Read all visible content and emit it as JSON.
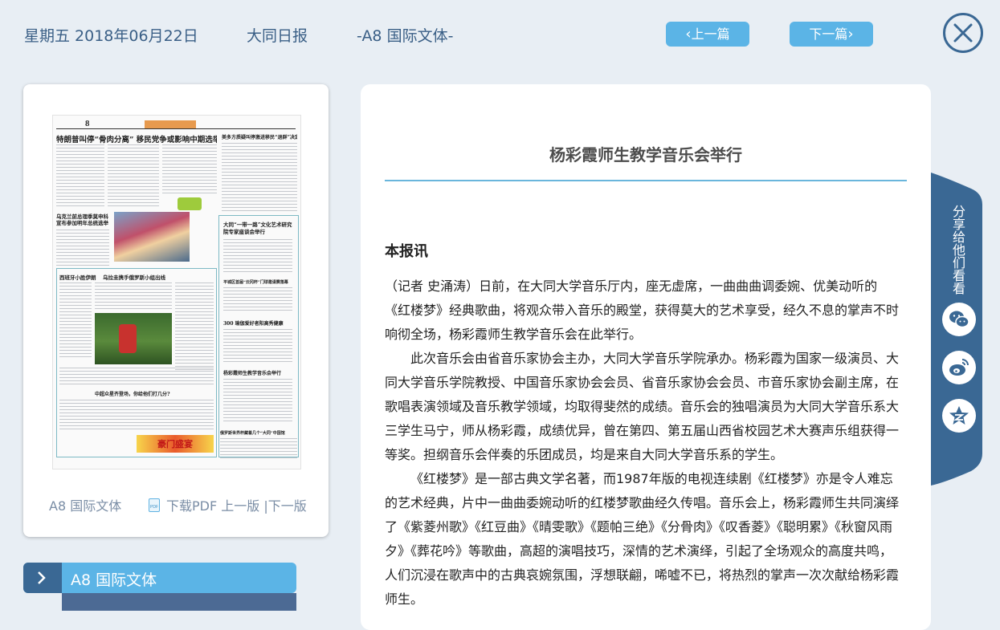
{
  "header": {
    "date": "星期五 2018年06月22日",
    "newspaper": "大同日报",
    "section": "-A8 国际文体-",
    "prev_label": "上一篇",
    "next_label": "下一篇"
  },
  "thumbnail": {
    "page_label": "A8 国际文体",
    "download_label": "下载PDF",
    "prev_page_label": "上一版",
    "separator": "|",
    "next_page_label": "下一版",
    "page_number": "8",
    "headlines": {
      "top": "特朗普叫停“骨肉分离” 移民党争或影响中期选举",
      "right_top": "美多方质疑叫停激进移民“退群”决定",
      "left_mid": "乌克兰前总理季莫申科宣布参加明年总统选举",
      "box_title": "大同“一带一路”文化艺术研究院专家座谈会举行",
      "box_sub": "平城区首届“云冈杯”门球邀请赛落幕",
      "sport_left": "西班牙小胜伊朗",
      "sport_mid": "乌拉圭携手俄罗斯小组出线",
      "sport_right": "300 瑜伽爱好者阳高秀健康",
      "music": "杨彩霞师生教学音乐会举行",
      "china": "中超众星齐登场，你给他们打几分?",
      "bottom_right": "俄罗斯世界杯藏着几个“大同”中国馆",
      "banner": "豪门盛宴"
    }
  },
  "menu": {
    "active_label": "A8  国际文体"
  },
  "article": {
    "title": "杨彩霞师生教学音乐会举行",
    "subhead": "本报讯",
    "paragraphs": [
      "（记者 史涌涛）日前，在大同大学音乐厅内，座无虚席，一曲曲曲调委婉、优美动听的《红楼梦》经典歌曲，将观众带入音乐的殿堂，获得莫大的艺术享受，经久不息的掌声不时响彻全场，杨彩霞师生教学音乐会在此举行。",
      "此次音乐会由省音乐家协会主办，大同大学音乐学院承办。杨彩霞为国家一级演员、大同大学音乐学院教授、中国音乐家协会会员、省音乐家协会会员、市音乐家协会副主席，在歌唱表演领域及音乐教学领域，均取得斐然的成绩。音乐会的独唱演员为大同大学音乐系大三学生马宁，师从杨彩霞，成绩优异，曾在第四、第五届山西省校园艺术大赛声乐组获得一等奖。担纲音乐会伴奏的乐团成员，均是来自大同大学音乐系的学生。",
      "《红楼梦》是一部古典文学名著，而1987年版的电视连续剧《红楼梦》亦是令人难忘的艺术经典，片中一曲曲委婉动听的红楼梦歌曲经久传唱。音乐会上，杨彩霞师生共同演绎了《紫菱州歌》《红豆曲》《晴雯歌》《题帕三绝》《分骨肉》《叹香菱》《聪明累》《秋窗风雨夕》《葬花吟》等歌曲，高超的演唱技巧，深情的艺术演绎，引起了全场观众的高度共鸣，人们沉浸在歌声中的古典哀婉氛围，浮想联翩，唏嘘不已，将热烈的掌声一次次献给杨彩霞师生。"
    ]
  },
  "share": {
    "label": "分享给他们看看",
    "icons": [
      "wechat-icon",
      "weibo-icon",
      "qzone-icon"
    ]
  },
  "colors": {
    "accent": "#5bb4e6",
    "dark": "#3a6894",
    "background": "#e8eef4"
  }
}
